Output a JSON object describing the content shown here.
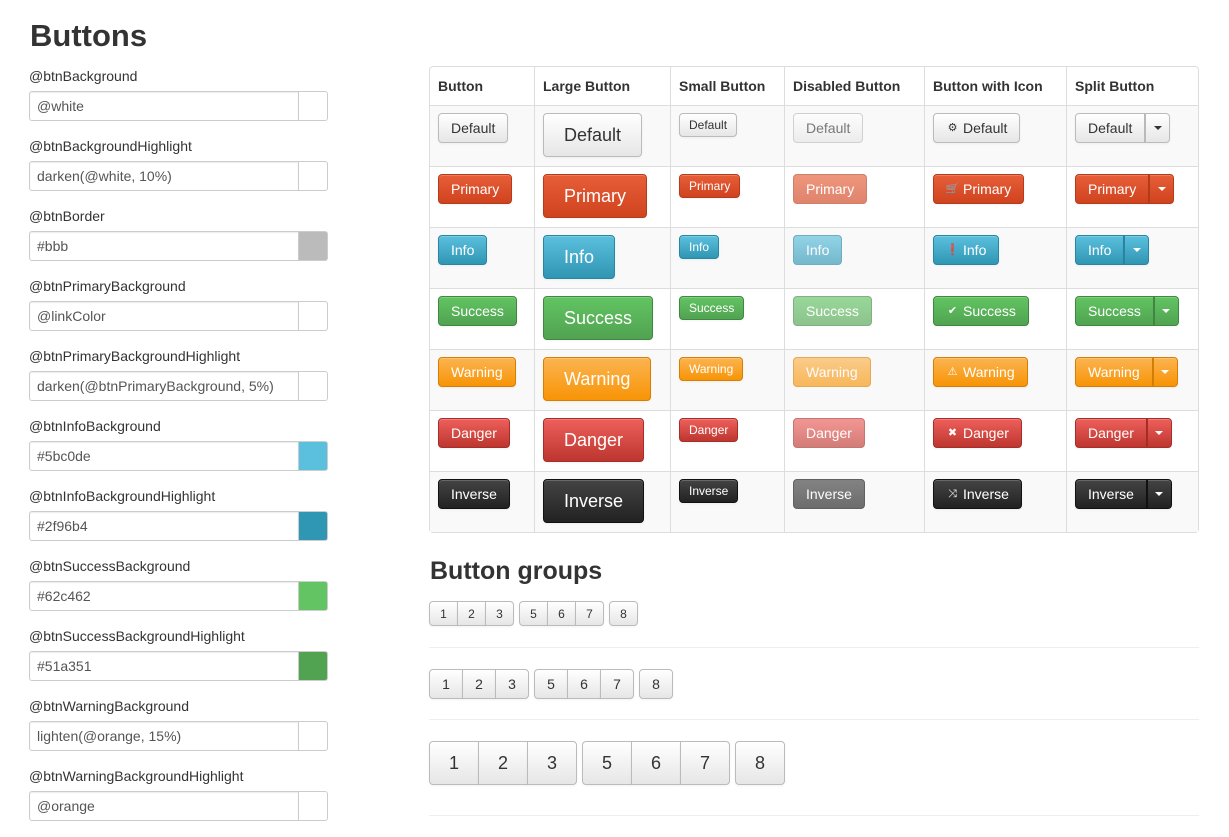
{
  "page": {
    "title": "Buttons"
  },
  "variables": [
    {
      "label": "@btnBackground",
      "value": "@white",
      "swatch": "#ffffff"
    },
    {
      "label": "@btnBackgroundHighlight",
      "value": "darken(@white, 10%)",
      "swatch": "#ffffff"
    },
    {
      "label": "@btnBorder",
      "value": "#bbb",
      "swatch": "#bbbbbb"
    },
    {
      "label": "@btnPrimaryBackground",
      "value": "@linkColor",
      "swatch": "#ffffff"
    },
    {
      "label": "@btnPrimaryBackgroundHighlight",
      "value": "darken(@btnPrimaryBackground, 5%)",
      "swatch": "#ffffff"
    },
    {
      "label": "@btnInfoBackground",
      "value": "#5bc0de",
      "swatch": "#5bc0de"
    },
    {
      "label": "@btnInfoBackgroundHighlight",
      "value": "#2f96b4",
      "swatch": "#2f96b4"
    },
    {
      "label": "@btnSuccessBackground",
      "value": "#62c462",
      "swatch": "#62c462"
    },
    {
      "label": "@btnSuccessBackgroundHighlight",
      "value": "#51a351",
      "swatch": "#51a351"
    },
    {
      "label": "@btnWarningBackground",
      "value": "lighten(@orange, 15%)",
      "swatch": "#ffffff"
    },
    {
      "label": "@btnWarningBackgroundHighlight",
      "value": "@orange",
      "swatch": "#ffffff"
    }
  ],
  "table": {
    "headers": [
      "Button",
      "Large Button",
      "Small Button",
      "Disabled Button",
      "Button with Icon",
      "Split Button"
    ],
    "rows": [
      {
        "variant": "default",
        "label": "Default",
        "icon": "gear-icon",
        "glyph": "⚙"
      },
      {
        "variant": "primary",
        "label": "Primary",
        "icon": "shopping-cart-icon",
        "glyph": "🛒"
      },
      {
        "variant": "info",
        "label": "Info",
        "icon": "exclamation-circle-icon",
        "glyph": "❗"
      },
      {
        "variant": "success",
        "label": "Success",
        "icon": "check-icon",
        "glyph": "✔"
      },
      {
        "variant": "warning",
        "label": "Warning",
        "icon": "warning-triangle-icon",
        "glyph": "⚠"
      },
      {
        "variant": "danger",
        "label": "Danger",
        "icon": "close-icon",
        "glyph": "✖"
      },
      {
        "variant": "inverse",
        "label": "Inverse",
        "icon": "shuffle-icon",
        "glyph": "⤨"
      }
    ]
  },
  "button_groups": {
    "title": "Button groups",
    "groups": [
      [
        "1",
        "2",
        "3"
      ],
      [
        "5",
        "6",
        "7"
      ],
      [
        "8"
      ]
    ]
  },
  "colors": {
    "primary": "#d0431f",
    "info": "#2f96b4",
    "success": "#51a351",
    "warning": "#f89406",
    "danger": "#bd362f",
    "inverse": "#222222"
  }
}
